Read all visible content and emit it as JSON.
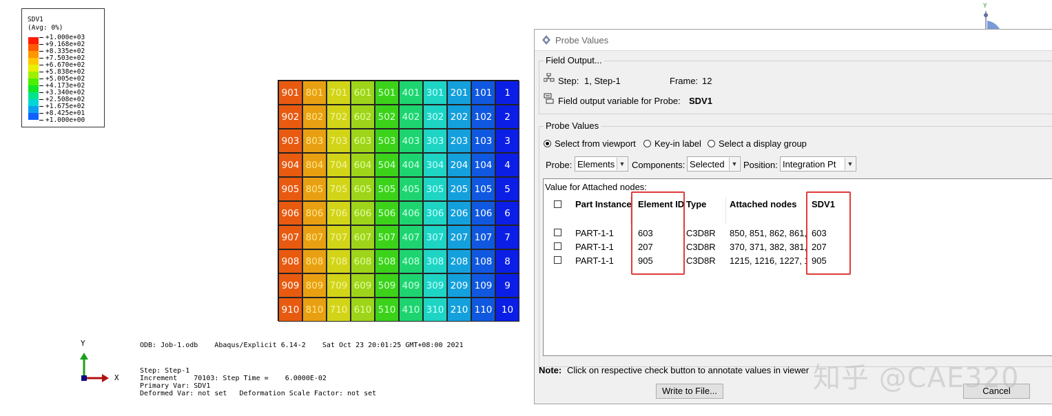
{
  "legend": {
    "title": "SDV1",
    "subtitle": "(Avg: 0%)",
    "values": [
      "+1.000e+03",
      "+9.168e+02",
      "+8.335e+02",
      "+7.503e+02",
      "+6.670e+02",
      "+5.838e+02",
      "+5.005e+02",
      "+4.173e+02",
      "+3.340e+02",
      "+2.508e+02",
      "+1.675e+02",
      "+8.425e+01",
      "+1.000e+00"
    ],
    "colors": [
      "#ff1a00",
      "#ff5a00",
      "#ff9600",
      "#ffc800",
      "#e6f000",
      "#9ef000",
      "#4cf000",
      "#10e62a",
      "#00e48c",
      "#00d6d6",
      "#0aa0f0",
      "#1060ff",
      "#0000f0"
    ]
  },
  "grid": {
    "column_colors": [
      "#e85a10",
      "#e8a012",
      "#d2d418",
      "#9ed41a",
      "#3cd21a",
      "#1ed470",
      "#1ed4c4",
      "#14a0dc",
      "#1058e0",
      "#0a1ee6"
    ],
    "label_colors": [
      "#ffffff",
      "#ffe68c",
      "#f4f4a0",
      "#e2ffa0",
      "#d4ffd0",
      "#ccffe6",
      "#c8ffff",
      "#ffffff",
      "#ffffff",
      "#ffffff"
    ],
    "rows": [
      [
        "901",
        "801",
        "701",
        "601",
        "501",
        "401",
        "301",
        "201",
        "101",
        "1"
      ],
      [
        "902",
        "802",
        "702",
        "602",
        "502",
        "402",
        "302",
        "202",
        "102",
        "2"
      ],
      [
        "903",
        "803",
        "703",
        "603",
        "503",
        "403",
        "303",
        "203",
        "103",
        "3"
      ],
      [
        "904",
        "804",
        "704",
        "604",
        "504",
        "404",
        "304",
        "204",
        "104",
        "4"
      ],
      [
        "905",
        "805",
        "705",
        "605",
        "505",
        "405",
        "305",
        "205",
        "105",
        "5"
      ],
      [
        "906",
        "806",
        "706",
        "606",
        "506",
        "406",
        "306",
        "206",
        "106",
        "6"
      ],
      [
        "907",
        "807",
        "707",
        "607",
        "507",
        "407",
        "307",
        "207",
        "107",
        "7"
      ],
      [
        "908",
        "808",
        "708",
        "608",
        "508",
        "408",
        "308",
        "208",
        "108",
        "8"
      ],
      [
        "909",
        "809",
        "709",
        "609",
        "509",
        "409",
        "309",
        "209",
        "109",
        "9"
      ],
      [
        "910",
        "810",
        "710",
        "610",
        "510",
        "410",
        "310",
        "210",
        "110",
        "10"
      ]
    ]
  },
  "triad": {
    "y": "Y",
    "x": "X",
    "mini_y": "Y"
  },
  "viewport_info": {
    "odb_line": "ODB: Job-1.odb    Abaqus/Explicit 6.14-2    Sat Oct 23 20:01:25 GMT+08:00 2021",
    "step": "Step: Step-1",
    "increment": "Increment    70103: Step Time =    6.0000E-02",
    "primary_var": "Primary Var: SDV1",
    "deformed_var": "Deformed Var: not set   Deformation Scale Factor: not set"
  },
  "dialog": {
    "title": "Probe Values",
    "field_output": {
      "group_label": "Field Output...",
      "step_label": "Step:",
      "step_value": "1, Step-1",
      "frame_label": "Frame:",
      "frame_value": "12",
      "variable_label": "Field output variable for Probe:",
      "variable_value": "SDV1"
    },
    "probe_values": {
      "group_label": "Probe Values",
      "radio_viewport": "Select from viewport",
      "radio_keyin": "Key-in label",
      "radio_display_group": "Select a display group",
      "probe_label": "Probe:",
      "probe_value": "Elements",
      "components_label": "Components:",
      "components_value": "Selected",
      "position_label": "Position:",
      "position_value": "Integration Pt"
    },
    "table": {
      "caption": "Value for Attached nodes:",
      "headers": [
        "Part Instance",
        "Element ID",
        "Type",
        "Attached nodes",
        "SDV1"
      ],
      "rows": [
        [
          "PART-1-1",
          "603",
          "C3D8R",
          "850, 851, 862, 861,",
          "603"
        ],
        [
          "PART-1-1",
          "207",
          "C3D8R",
          "370, 371, 382, 381,",
          "207"
        ],
        [
          "PART-1-1",
          "905",
          "C3D8R",
          "1215, 1216, 1227, 1",
          "905"
        ]
      ]
    },
    "note_label": "Note:",
    "note_text": "Click on respective check button to annotate values in viewer",
    "write_button": "Write to File...",
    "cancel_button": "Cancel"
  },
  "watermark": "知乎 @CAE320"
}
